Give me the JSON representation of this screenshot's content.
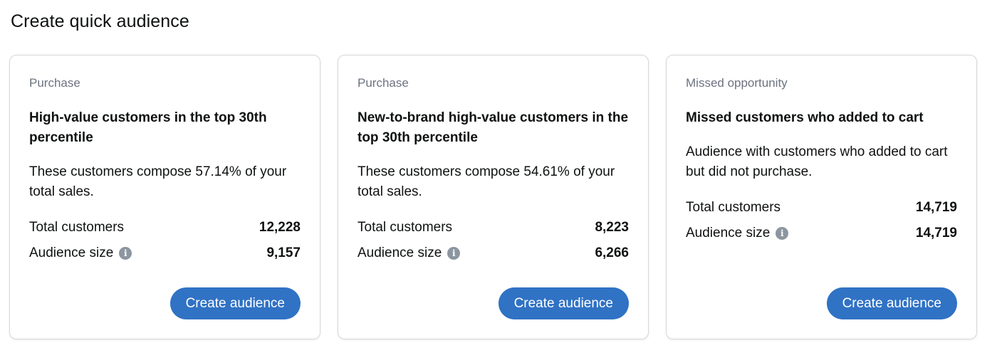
{
  "page": {
    "title": "Create quick audience"
  },
  "cards": [
    {
      "category": "Purchase",
      "title": "High-value customers in the top 30th percentile",
      "description": "These customers compose 57.14% of your total sales.",
      "total_customers_label": "Total customers",
      "total_customers_value": "12,228",
      "audience_size_label": "Audience size",
      "audience_size_value": "9,157",
      "button_label": "Create audience"
    },
    {
      "category": "Purchase",
      "title": "New-to-brand high-value customers in the top 30th percentile",
      "description": "These customers compose 54.61% of your total sales.",
      "total_customers_label": "Total customers",
      "total_customers_value": "8,223",
      "audience_size_label": "Audience size",
      "audience_size_value": "6,266",
      "button_label": "Create audience"
    },
    {
      "category": "Missed opportunity",
      "title": "Missed customers who added to cart",
      "description": "Audience with customers who added to cart but did not purchase.",
      "total_customers_label": "Total customers",
      "total_customers_value": "14,719",
      "audience_size_label": "Audience size",
      "audience_size_value": "14,719",
      "button_label": "Create audience"
    }
  ],
  "icons": {
    "info": "info-icon"
  },
  "colors": {
    "button": "#3072c4",
    "info_icon": "#8c96a0",
    "category_text": "#6b7280"
  }
}
